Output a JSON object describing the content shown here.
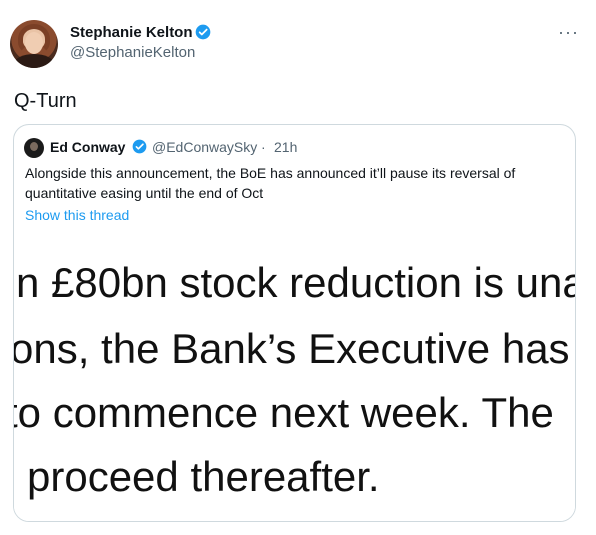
{
  "tweet": {
    "author_name": "Stephanie Kelton",
    "author_handle": "@StephanieKelton",
    "text": "Q-Turn",
    "more_icon": "···"
  },
  "quoted_tweet": {
    "author_name": "Ed Conway",
    "author_handle": "@EdConwaySky",
    "separator": "·",
    "time": "21h",
    "text": "Alongside this announcement, the BoE has announced it’ll pause its reversal of quantitative easing until the end of Oct",
    "show_thread_label": "Show this thread",
    "image_text": {
      "line1": "n £80bn stock reduction is una",
      "line2": "ons, the Bank’s Executive has",
      "line3": "to commence next week. The",
      "line4": "l proceed thereafter."
    }
  },
  "colors": {
    "verified": "#1d9bf0",
    "link": "#1d9bf0",
    "secondary_text": "#536471"
  }
}
